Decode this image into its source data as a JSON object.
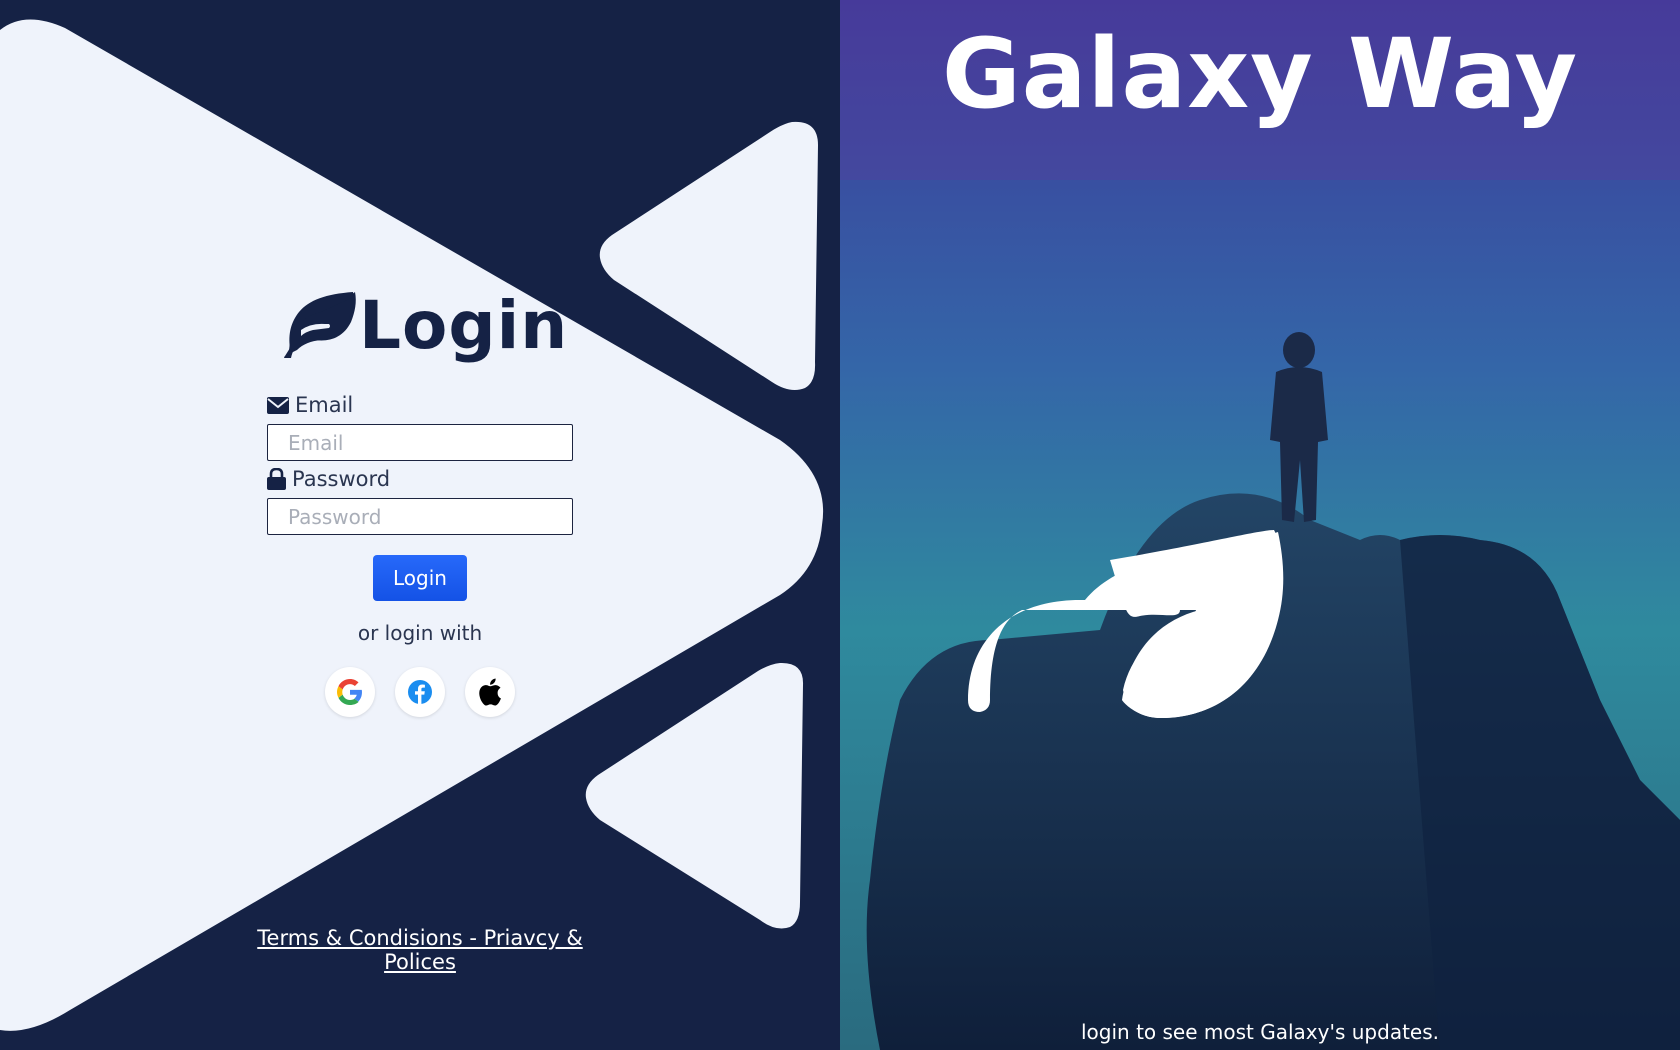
{
  "login_panel": {
    "title": "Login",
    "email": {
      "label": "Email",
      "placeholder": "Email"
    },
    "password": {
      "label": "Password",
      "placeholder": "Password"
    },
    "submit_label": "Login",
    "alt_login_text": "or login with",
    "social_providers": [
      {
        "name": "Google",
        "icon": "google-icon"
      },
      {
        "name": "Facebook",
        "icon": "facebook-icon"
      },
      {
        "name": "Apple",
        "icon": "apple-icon"
      }
    ],
    "footer_link": "Terms & Condisions - Priavcy & Polices"
  },
  "hero_panel": {
    "title": "Galaxy Way",
    "tagline": "login to see most Galaxy's updates."
  },
  "colors": {
    "navy": "#152245",
    "panel_light": "#eff3fb",
    "button_blue": "#1e63f5",
    "white": "#ffffff"
  }
}
